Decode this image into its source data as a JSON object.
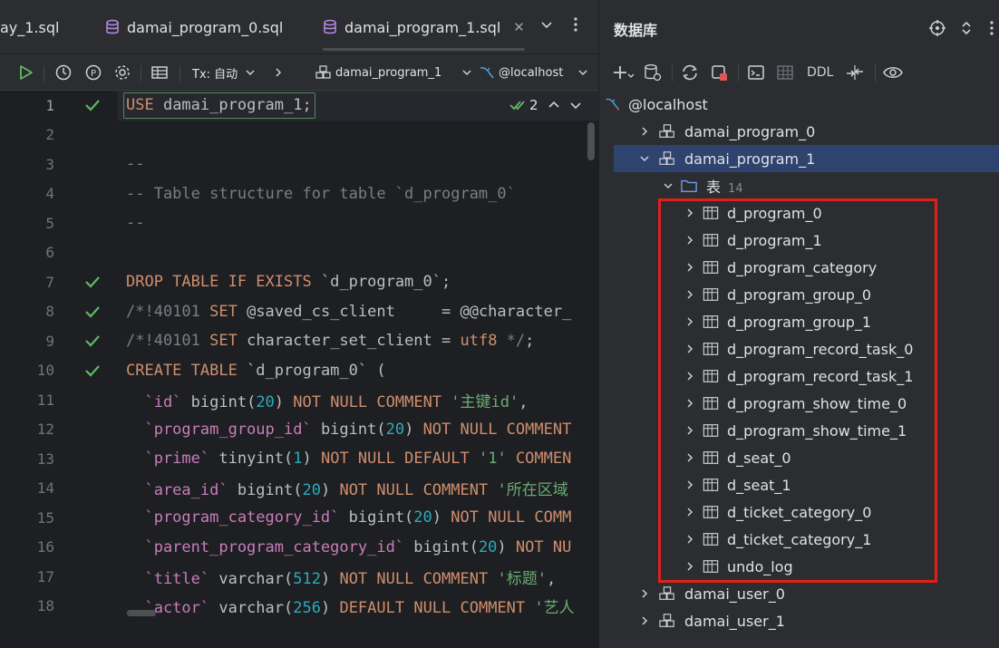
{
  "editor": {
    "tabs": [
      {
        "label": "ay_1.sql",
        "active": false
      },
      {
        "label": "damai_program_0.sql",
        "active": false
      },
      {
        "label": "damai_program_1.sql",
        "active": true
      }
    ],
    "toolbar": {
      "tx_label": "Tx: 自动",
      "schema_label": "damai_program_1",
      "datasource_label": "@localhost"
    },
    "inspection_count": "2",
    "lines": [
      {
        "n": "1",
        "check": true,
        "tokens": [
          [
            "kw",
            "USE"
          ],
          [
            "plain",
            " damai_program_1;"
          ]
        ]
      },
      {
        "n": "2",
        "check": false,
        "tokens": []
      },
      {
        "n": "3",
        "check": false,
        "tokens": [
          [
            "cm",
            "--"
          ]
        ]
      },
      {
        "n": "4",
        "check": false,
        "tokens": [
          [
            "cm",
            "-- Table structure for table `d_program_0`"
          ]
        ]
      },
      {
        "n": "5",
        "check": false,
        "tokens": [
          [
            "cm",
            "--"
          ]
        ]
      },
      {
        "n": "6",
        "check": false,
        "tokens": []
      },
      {
        "n": "7",
        "check": true,
        "tokens": [
          [
            "kw",
            "DROP TABLE IF EXISTS "
          ],
          [
            "plain",
            "`d_program_0`;"
          ]
        ]
      },
      {
        "n": "8",
        "check": true,
        "tokens": [
          [
            "cm",
            "/*!40101 "
          ],
          [
            "kw",
            "SET "
          ],
          [
            "plain",
            "@saved_cs_client     = @@character_"
          ]
        ]
      },
      {
        "n": "9",
        "check": true,
        "tokens": [
          [
            "cm",
            "/*!40101 "
          ],
          [
            "kw",
            "SET "
          ],
          [
            "plain",
            "character_set_client = "
          ],
          [
            "kw",
            "utf8 "
          ],
          [
            "cm",
            "*/"
          ],
          [
            "plain",
            ";"
          ]
        ]
      },
      {
        "n": "10",
        "check": true,
        "tokens": [
          [
            "kw",
            "CREATE TABLE "
          ],
          [
            "plain",
            "`d_program_0` ("
          ]
        ]
      },
      {
        "n": "11",
        "check": false,
        "tokens": [
          [
            "id",
            "  `id` "
          ],
          [
            "plain",
            "bigint("
          ],
          [
            "num",
            "20"
          ],
          [
            "plain",
            ") "
          ],
          [
            "kw",
            "NOT NULL COMMENT "
          ],
          [
            "str",
            "'主键id'"
          ],
          [
            "plain",
            ","
          ]
        ]
      },
      {
        "n": "12",
        "check": false,
        "tokens": [
          [
            "id",
            "  `program_group_id` "
          ],
          [
            "plain",
            "bigint("
          ],
          [
            "num",
            "20"
          ],
          [
            "plain",
            ") "
          ],
          [
            "kw",
            "NOT NULL COMMENT"
          ]
        ]
      },
      {
        "n": "13",
        "check": false,
        "tokens": [
          [
            "id",
            "  `prime` "
          ],
          [
            "plain",
            "tinyint("
          ],
          [
            "num",
            "1"
          ],
          [
            "plain",
            ") "
          ],
          [
            "kw",
            "NOT NULL DEFAULT "
          ],
          [
            "str",
            "'1' "
          ],
          [
            "kw",
            "COMMEN"
          ]
        ]
      },
      {
        "n": "14",
        "check": false,
        "tokens": [
          [
            "id",
            "  `area_id` "
          ],
          [
            "plain",
            "bigint("
          ],
          [
            "num",
            "20"
          ],
          [
            "plain",
            ") "
          ],
          [
            "kw",
            "NOT NULL COMMENT "
          ],
          [
            "str",
            "'所在区域"
          ]
        ]
      },
      {
        "n": "15",
        "check": false,
        "tokens": [
          [
            "id",
            "  `program_category_id` "
          ],
          [
            "plain",
            "bigint("
          ],
          [
            "num",
            "20"
          ],
          [
            "plain",
            ") "
          ],
          [
            "kw",
            "NOT NULL COMM"
          ]
        ]
      },
      {
        "n": "16",
        "check": false,
        "tokens": [
          [
            "id",
            "  `parent_program_category_id` "
          ],
          [
            "plain",
            "bigint("
          ],
          [
            "num",
            "20"
          ],
          [
            "plain",
            ") "
          ],
          [
            "kw",
            "NOT NU"
          ]
        ]
      },
      {
        "n": "17",
        "check": false,
        "tokens": [
          [
            "id",
            "  `title` "
          ],
          [
            "plain",
            "varchar("
          ],
          [
            "num",
            "512"
          ],
          [
            "plain",
            ") "
          ],
          [
            "kw",
            "NOT NULL COMMENT "
          ],
          [
            "str",
            "'标题'"
          ],
          [
            "plain",
            ","
          ]
        ]
      },
      {
        "n": "18",
        "check": false,
        "tokens": [
          [
            "id",
            "  `actor` "
          ],
          [
            "plain",
            "varchar("
          ],
          [
            "num",
            "256"
          ],
          [
            "plain",
            ") "
          ],
          [
            "kw",
            "DEFAULT NULL COMMENT "
          ],
          [
            "str",
            "'艺人"
          ]
        ]
      }
    ]
  },
  "db_panel": {
    "title": "数据库",
    "toolbar": {
      "ddl_label": "DDL"
    },
    "tree": [
      {
        "level": 0,
        "kind": "datasource",
        "label": "@localhost",
        "expand": "none"
      },
      {
        "level": 1,
        "kind": "schema",
        "label": "damai_program_0",
        "expand": "collapsed"
      },
      {
        "level": 1,
        "kind": "schema",
        "label": "damai_program_1",
        "expand": "expanded",
        "selected": true
      },
      {
        "level": 2,
        "kind": "folder",
        "label": "表",
        "count": "14",
        "expand": "expanded"
      },
      {
        "level": 3,
        "kind": "table",
        "label": "d_program_0",
        "expand": "collapsed"
      },
      {
        "level": 3,
        "kind": "table",
        "label": "d_program_1",
        "expand": "collapsed"
      },
      {
        "level": 3,
        "kind": "table",
        "label": "d_program_category",
        "expand": "collapsed"
      },
      {
        "level": 3,
        "kind": "table",
        "label": "d_program_group_0",
        "expand": "collapsed"
      },
      {
        "level": 3,
        "kind": "table",
        "label": "d_program_group_1",
        "expand": "collapsed"
      },
      {
        "level": 3,
        "kind": "table",
        "label": "d_program_record_task_0",
        "expand": "collapsed"
      },
      {
        "level": 3,
        "kind": "table",
        "label": "d_program_record_task_1",
        "expand": "collapsed"
      },
      {
        "level": 3,
        "kind": "table",
        "label": "d_program_show_time_0",
        "expand": "collapsed"
      },
      {
        "level": 3,
        "kind": "table",
        "label": "d_program_show_time_1",
        "expand": "collapsed"
      },
      {
        "level": 3,
        "kind": "table",
        "label": "d_seat_0",
        "expand": "collapsed"
      },
      {
        "level": 3,
        "kind": "table",
        "label": "d_seat_1",
        "expand": "collapsed"
      },
      {
        "level": 3,
        "kind": "table",
        "label": "d_ticket_category_0",
        "expand": "collapsed"
      },
      {
        "level": 3,
        "kind": "table",
        "label": "d_ticket_category_1",
        "expand": "collapsed"
      },
      {
        "level": 3,
        "kind": "table",
        "label": "undo_log",
        "expand": "collapsed"
      },
      {
        "level": 1,
        "kind": "schema",
        "label": "damai_user_0",
        "expand": "collapsed"
      },
      {
        "level": 1,
        "kind": "schema",
        "label": "damai_user_1",
        "expand": "collapsed"
      }
    ]
  },
  "colors": {
    "accent_selection": "#2e436e",
    "highlight_box": "#e0201b",
    "check_green": "#5fb865",
    "run_green": "#5fb865",
    "keyword": "#cf8e6d",
    "string": "#6aab73",
    "number": "#2aacb8",
    "comment": "#7a7e85",
    "identifier": "#c77dbb"
  }
}
